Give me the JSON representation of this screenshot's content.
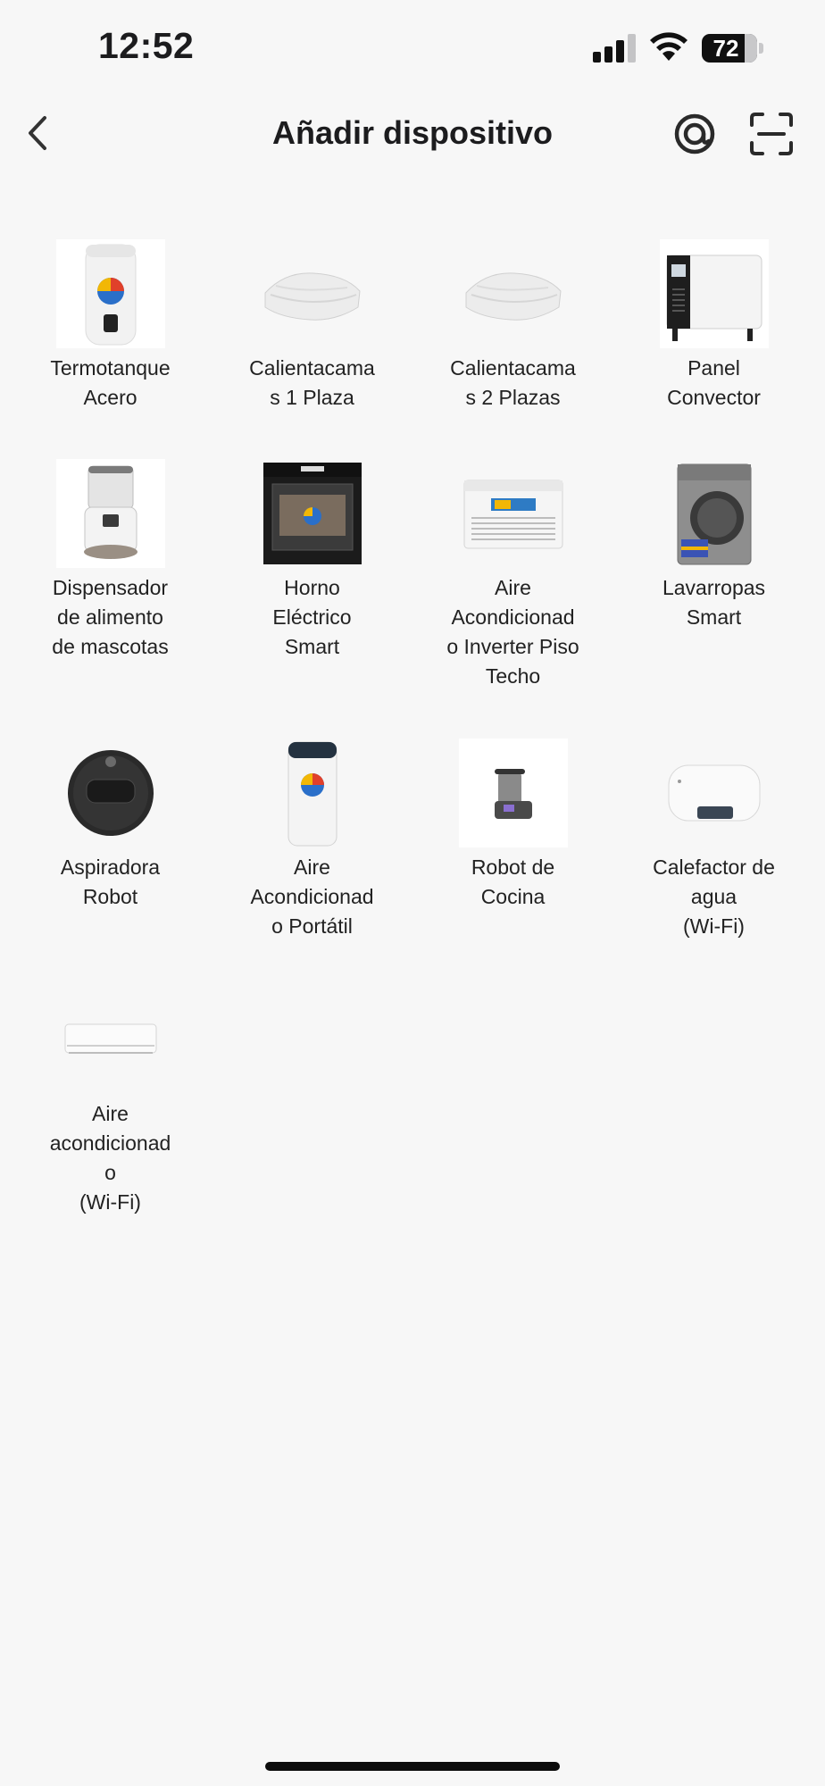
{
  "status_bar": {
    "time": "12:52",
    "battery": "72"
  },
  "header": {
    "title": "Añadir dispositivo",
    "back_icon": "chevron-left-icon",
    "radar_icon": "radar-scan-icon",
    "scan_icon": "qr-scan-icon"
  },
  "devices": [
    {
      "label": "Termotanque\nAcero",
      "icon": "water-heater"
    },
    {
      "label": "Calientacama\ns 1 Plaza",
      "icon": "electric-blanket"
    },
    {
      "label": "Calientacama\ns 2 Plazas",
      "icon": "electric-blanket"
    },
    {
      "label": "Panel\nConvector",
      "icon": "convector-heater"
    },
    {
      "label": "Dispensador\nde alimento\nde mascotas",
      "icon": "pet-feeder"
    },
    {
      "label": "Horno\nEléctrico\nSmart",
      "icon": "electric-oven"
    },
    {
      "label": "Aire\nAcondicionad\no Inverter Piso\nTecho",
      "icon": "ceiling-ac"
    },
    {
      "label": "Lavarropas\nSmart",
      "icon": "washing-machine"
    },
    {
      "label": "Aspiradora\nRobot",
      "icon": "robot-vacuum"
    },
    {
      "label": "Aire\nAcondicionad\no Portátil",
      "icon": "portable-ac"
    },
    {
      "label": "Robot de\nCocina",
      "icon": "kitchen-robot"
    },
    {
      "label": "Calefactor de\nagua\n(Wi-Fi)",
      "icon": "wall-water-heater"
    },
    {
      "label": "Aire\nacondicionad\no\n(Wi-Fi)",
      "icon": "split-ac"
    }
  ],
  "colors": {
    "background": "#f7f7f7",
    "text": "#1c1c1e"
  }
}
